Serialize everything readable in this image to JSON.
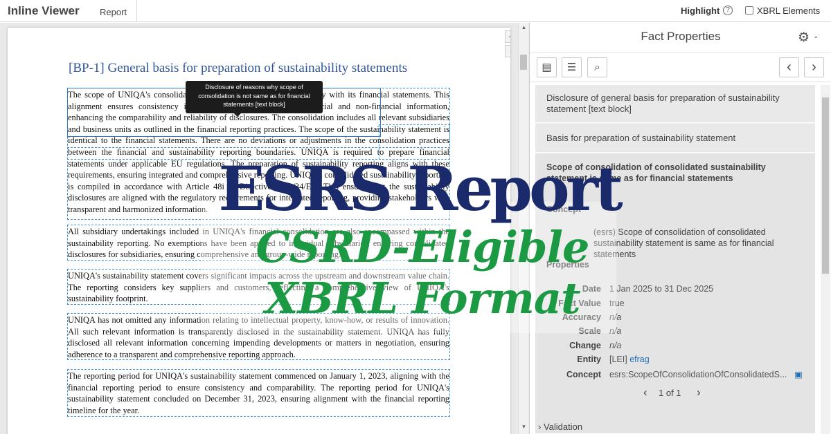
{
  "topbar": {
    "app_title": "Inline Viewer",
    "report_link": "Report",
    "highlight_label": "Highlight",
    "help_glyph": "?",
    "xbrl_elements_label": "XBRL Elements"
  },
  "document": {
    "zoom_in": "+",
    "zoom_out": "-",
    "heading": "[BP-1] General basis for preparation of sustainability statements",
    "tooltip": "Disclosure of reasons why scope of consolidation is not same as for financial statements [text block]",
    "paragraphs": [
      "The scope of UNIQA's consolidated sustainability statement aligns fully with its financial statements. This alignment ensures consistency in reporting and enhances the financial and non-financial information, enhancing the comparability and reliability of disclosures. The consolidation includes all relevant subsidiaries and business units as outlined in the financial reporting practices. The scope of the sustainability statement is identical to the financial statements. There are no deviations or adjustments in the consolidation practices between the financial and sustainability reporting boundaries. UNIQA is required to prepare financial statements under applicable EU regulations. The preparation of sustainability reporting aligns with these requirements, ensuring integrated and comprehensive reporting. UNIQA's consolidated sustainability reporting is compiled in accordance with Article 48i of Directive 2013/34/EU. This ensures that the sustainability disclosures are aligned with the regulatory requirements for integrated reporting, providing stakeholders with transparent and harmonized information.",
      "All subsidiary undertakings included in UNIQA's financial consolidation are also encompassed within the sustainability reporting. No exemptions have been applied to individual subsidiaries, ensuring consolidated disclosures for subsidiaries, ensuring comprehensive and group-wide reporting.",
      "UNIQA's sustainability statement covers significant impacts across the upstream and downstream value chain. The reporting considers key suppliers and customers, reflecting a comprehensive view of UNIQA's sustainability footprint.",
      "UNIQA has not omitted any information relating to intellectual property, know-how, or results of innovation. All such relevant information is transparently disclosed in the sustainability statement. UNIQA has fully disclosed all relevant information concerning impending developments or matters in negotiation, ensuring adherence to a transparent and comprehensive reporting approach.",
      "The reporting period for UNIQA's sustainability statement commenced on January 1, 2023, aligning with the financial reporting period to ensure consistency and comparability. The reporting period for UNIQA's sustainability statement concluded on December 31, 2023, ensuring alignment with the financial reporting timeline for the year."
    ]
  },
  "panel": {
    "title": "Fact Properties",
    "gear_icon": "gear-icon",
    "gear_glyph": "⚙",
    "caret_glyph": "⌄",
    "toolbar": {
      "text_block_glyph": "▤",
      "list_glyph": "☰",
      "search_glyph": "⌕",
      "prev_glyph": "‹",
      "next_glyph": "›"
    },
    "cards": [
      "Disclosure of general basis for preparation of sustainability statement [text block]",
      "Basis for preparation of sustainability statement"
    ],
    "active_fact": {
      "title": "Scope of consolidation of consolidated sustainability statement is same as for financial statements",
      "concept_heading": "Concept",
      "concept_label": "(esrs) Scope of consolidation of consolidated sustainability statement is same as for financial statements",
      "properties_heading": "Properties",
      "properties": [
        {
          "label": "Date",
          "value": "1 Jan 2025 to 31 Dec 2025"
        },
        {
          "label": "Fact Value",
          "value": "true"
        },
        {
          "label": "Accuracy",
          "value": "n/a"
        },
        {
          "label": "Scale",
          "value": "n/a"
        },
        {
          "label": "Change",
          "value": "n/a"
        }
      ],
      "entity_label": "Entity",
      "entity_prefix": "[LEI]",
      "entity_link": "efrag",
      "concept_row_label": "Concept",
      "concept_value": "esrs:ScopeOfConsolidationOfConsolidatedS...",
      "pager": "1 of 1",
      "pager_prev": "‹",
      "pager_next": "›"
    },
    "validation": "Validation",
    "validation_caret": "›"
  },
  "overlay": {
    "line1": "ESRS Report",
    "line2": "CSRD-Eligible",
    "line3": "XBRL Format"
  }
}
